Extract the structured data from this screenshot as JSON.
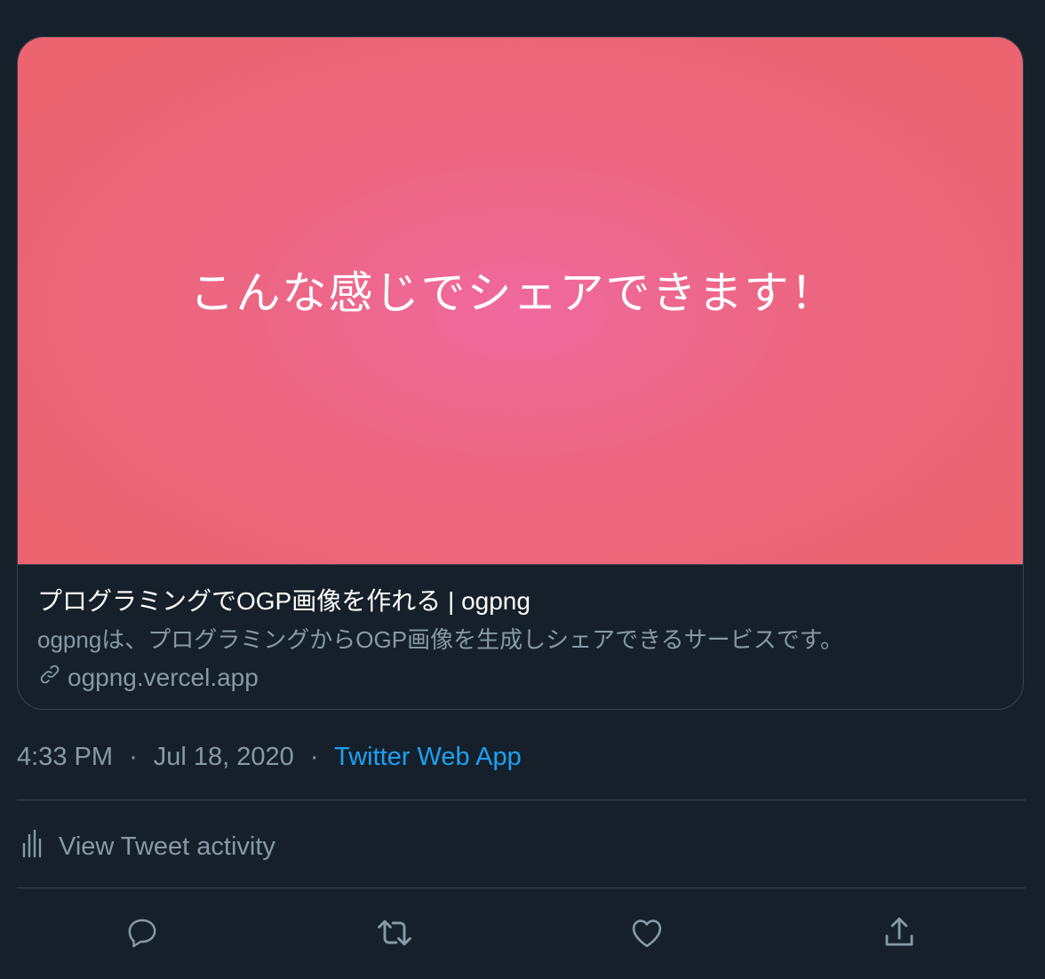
{
  "card": {
    "image_text": "こんな感じでシェアできます！",
    "title": "プログラミングでOGP画像を作れる | ogpng",
    "description": "ogpngは、プログラミングからOGP画像を生成しシェアできるサービスです。",
    "domain": "ogpng.vercel.app",
    "domain_icon": "link-icon"
  },
  "meta": {
    "time": "4:33 PM",
    "separator": "·",
    "date": "Jul 18, 2020",
    "source": "Twitter Web App"
  },
  "activity": {
    "label": "View Tweet activity",
    "icon": "bar-chart-icon"
  },
  "actions": [
    {
      "name": "reply",
      "icon": "reply-icon"
    },
    {
      "name": "retweet",
      "icon": "retweet-icon"
    },
    {
      "name": "like",
      "icon": "heart-icon"
    },
    {
      "name": "share",
      "icon": "share-icon"
    }
  ],
  "colors": {
    "background": "#15202b",
    "border": "#38444d",
    "secondary_text": "#8899a6",
    "accent": "#1da1f2",
    "card_image_center": "#f0699e",
    "card_image_edge": "#eb6470"
  }
}
